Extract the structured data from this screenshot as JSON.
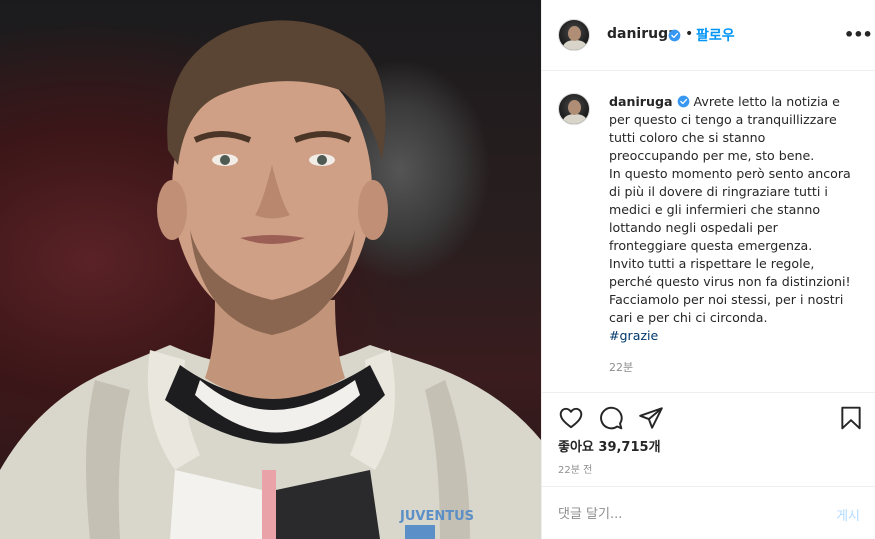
{
  "post": {
    "username": "daniruga",
    "follow_label": "팔로우",
    "separator": "•",
    "more_label": "•••"
  },
  "caption": {
    "username": "daniruga",
    "lines": [
      "Avrete letto la notizia e",
      "per questo ci tengo a tranquillizzare",
      "tutti coloro che si stanno",
      "preoccupando per me, sto bene.",
      "In questo momento però sento ancora",
      "di più il dovere di ringraziare tutti i",
      "medici e gli infermieri che stanno",
      "lottando negli ospedali per",
      "fronteggiare questa emergenza.",
      "Invito tutti a rispettare le regole,",
      "perché questo virus non fa distinzioni!",
      "Facciamolo per noi stessi, per i nostri",
      "cari e per chi ci circonda."
    ],
    "hashtag": "#grazie",
    "time": "22분"
  },
  "actions": {
    "likes": "좋아요 39,715개",
    "posted_time": "22분 전"
  },
  "comment": {
    "placeholder": "댓글 달기...",
    "post_label": "게시"
  },
  "photo": {
    "jersey_text": "JUVENTUS"
  },
  "colors": {
    "link_blue": "#0095f6",
    "verified_blue": "#3897f0",
    "hashtag": "#00376b",
    "muted": "#8e8e8e",
    "border": "#efefef"
  },
  "icons": {
    "like": "heart-icon",
    "comment": "comment-icon",
    "share": "paper-plane-icon",
    "save": "bookmark-icon",
    "verified": "verified-badge-icon",
    "more": "more-options-icon"
  }
}
